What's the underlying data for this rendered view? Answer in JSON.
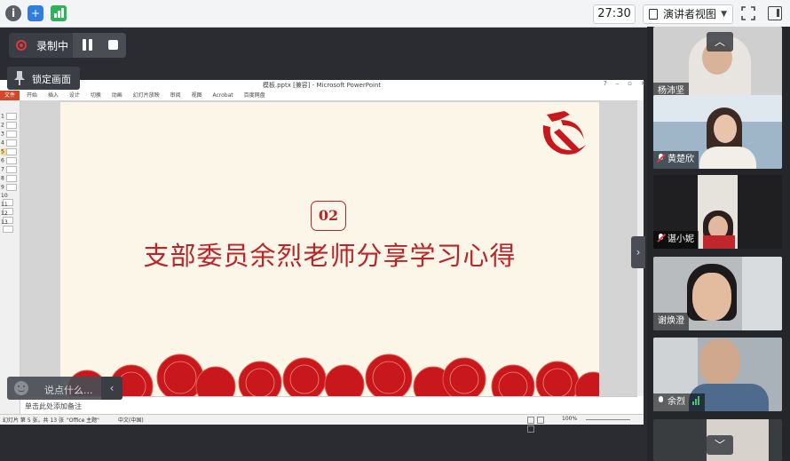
{
  "topbar": {
    "icons": [
      "info-icon",
      "shield-icon",
      "signal-icon"
    ],
    "timer": "27:30",
    "view_mode": "演讲者视图",
    "right_icons": [
      "fullscreen-icon",
      "side-panel-icon"
    ]
  },
  "recording": {
    "label": "录制中",
    "icons": [
      "record-icon",
      "pause-icon",
      "stop-icon"
    ],
    "lock_tooltip": "锁定画面"
  },
  "ppt": {
    "window_title": "模板.pptx [兼容] - Microsoft PowerPoint",
    "file_tab": "文件",
    "ribbon_tabs": [
      "开始",
      "插入",
      "设计",
      "切换",
      "动画",
      "幻灯片放映",
      "审阅",
      "视图",
      "Acrobat",
      "百度网盘"
    ],
    "thumbnail_numbers": [
      "1",
      "2",
      "3",
      "4",
      "5",
      "6",
      "7",
      "8",
      "9",
      "10",
      "11",
      "12",
      "13"
    ],
    "selected_slide": 5,
    "slide": {
      "number_badge": "02",
      "title": "支部委员余烈老师分享学习心得",
      "accent_color": "#b8262a"
    },
    "notes_placeholder": "单击此处添加备注",
    "status": {
      "slide_info": "幻灯片 第 5 张，共 13 张",
      "theme": "\"Office 主题\"",
      "language": "中文(中国)",
      "zoom": "100%"
    }
  },
  "chat": {
    "placeholder": "说点什么...",
    "collapse_icon": "chevron-left-icon"
  },
  "participants": [
    {
      "name": "杨沛坚",
      "mic": "none"
    },
    {
      "name": "黄楚欣",
      "mic": "muted"
    },
    {
      "name": "谌小妮",
      "mic": "muted"
    },
    {
      "name": "谢焕澄",
      "mic": "none"
    },
    {
      "name": "余烈",
      "mic": "active"
    }
  ]
}
